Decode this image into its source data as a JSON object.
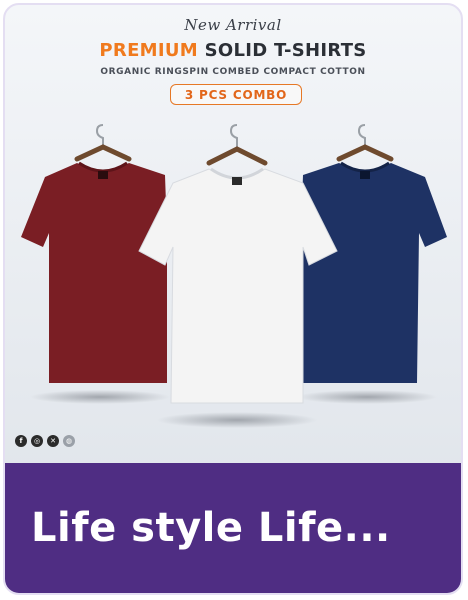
{
  "banner": {
    "new_arrival": "New Arrival",
    "headline_accent": "PREMIUM",
    "headline_rest": "SOLID T-SHIRTS",
    "subline": "ORGANIC RINGSPIN COMBED COMPACT COTTON",
    "combo_label": "3 PCS COMBO",
    "shirt_colors": {
      "maroon": "#7a1e24",
      "white": "#f4f4f4",
      "navy": "#1e3264"
    },
    "accent_color": "#f07a1e"
  },
  "socials": [
    "facebook-icon",
    "instagram-icon",
    "x-icon",
    "web-icon"
  ],
  "footer": {
    "title": "Life style Life...",
    "background": "#4f2d83"
  }
}
